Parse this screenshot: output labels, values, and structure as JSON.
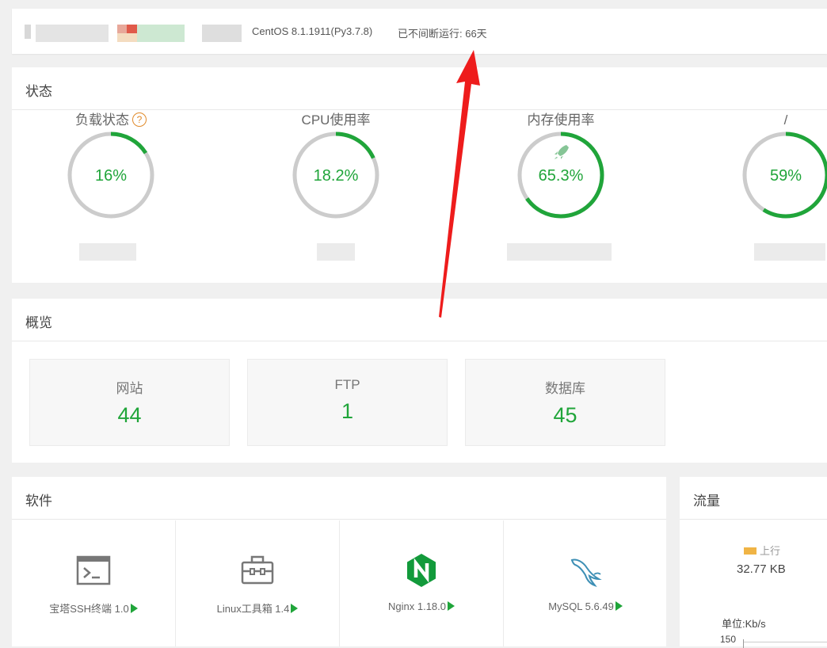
{
  "topbar": {
    "os": "CentOS 8.1.1911(Py3.7.8)",
    "uptime": "已不间断运行: 66天"
  },
  "status": {
    "title": "状态",
    "accent": "#20a53a",
    "gauges": [
      {
        "label": "负载状态",
        "value": "16%",
        "fraction": 0.16,
        "has_help": true
      },
      {
        "label": "CPU使用率",
        "value": "18.2%",
        "fraction": 0.182,
        "has_help": false
      },
      {
        "label": "内存使用率",
        "value": "65.3%",
        "fraction": 0.653,
        "has_help": false,
        "icon": "rocket-icon"
      },
      {
        "label": "/",
        "value": "59%",
        "fraction": 0.59,
        "has_help": false
      }
    ]
  },
  "overview": {
    "title": "概览",
    "items": [
      {
        "label": "网站",
        "value": "44"
      },
      {
        "label": "FTP",
        "value": "1"
      },
      {
        "label": "数据库",
        "value": "45"
      }
    ]
  },
  "software": {
    "title": "软件",
    "items": [
      {
        "name": "宝塔SSH终端 1.0",
        "icon": "terminal-icon"
      },
      {
        "name": "Linux工具箱 1.4",
        "icon": "toolbox-icon"
      },
      {
        "name": "Nginx 1.18.0",
        "icon": "nginx-icon"
      },
      {
        "name": "MySQL 5.6.49",
        "icon": "mysql-dolphin-icon"
      }
    ]
  },
  "traffic": {
    "title": "流量",
    "legend_up": "上行",
    "up_value": "32.77 KB",
    "unit": "单位:Kb/s",
    "ytick": "150"
  }
}
